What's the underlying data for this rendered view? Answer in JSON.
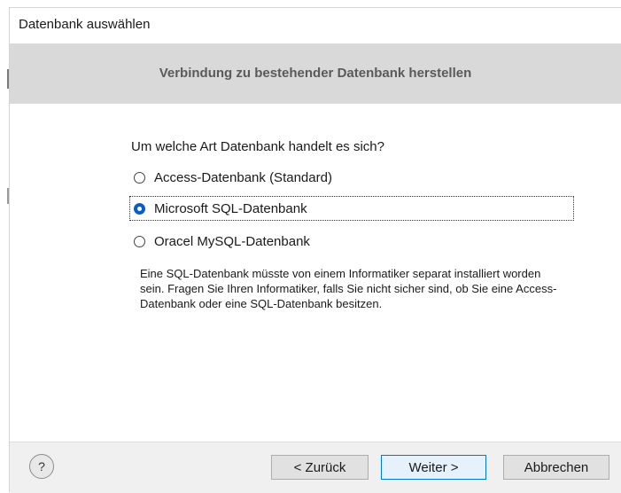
{
  "window": {
    "title": "Datenbank auswählen"
  },
  "header": {
    "title": "Verbindung zu bestehender Datenbank herstellen"
  },
  "main": {
    "question": "Um welche Art Datenbank handelt es sich?",
    "options": [
      {
        "label": "Access-Datenbank (Standard)",
        "selected": false
      },
      {
        "label": "Microsoft SQL-Datenbank",
        "selected": true
      },
      {
        "label": "Oracel MySQL-Datenbank",
        "selected": false
      }
    ],
    "description": "Eine SQL-Datenbank müsste von einem Informatiker separat installiert worden sein. Fragen Sie Ihren Informatiker, falls Sie nicht sicher sind, ob Sie eine Access-Datenbank oder eine SQL-Datenbank besitzen."
  },
  "footer": {
    "help_label": "?",
    "back_label": "< Zurück",
    "next_label": "Weiter >",
    "cancel_label": "Abbrechen"
  },
  "colors": {
    "header_band": "#d9d9d9",
    "header_text": "#5a5a5a",
    "radio_selected": "#0a5cc7",
    "footer_bg": "#f0f0f0"
  }
}
